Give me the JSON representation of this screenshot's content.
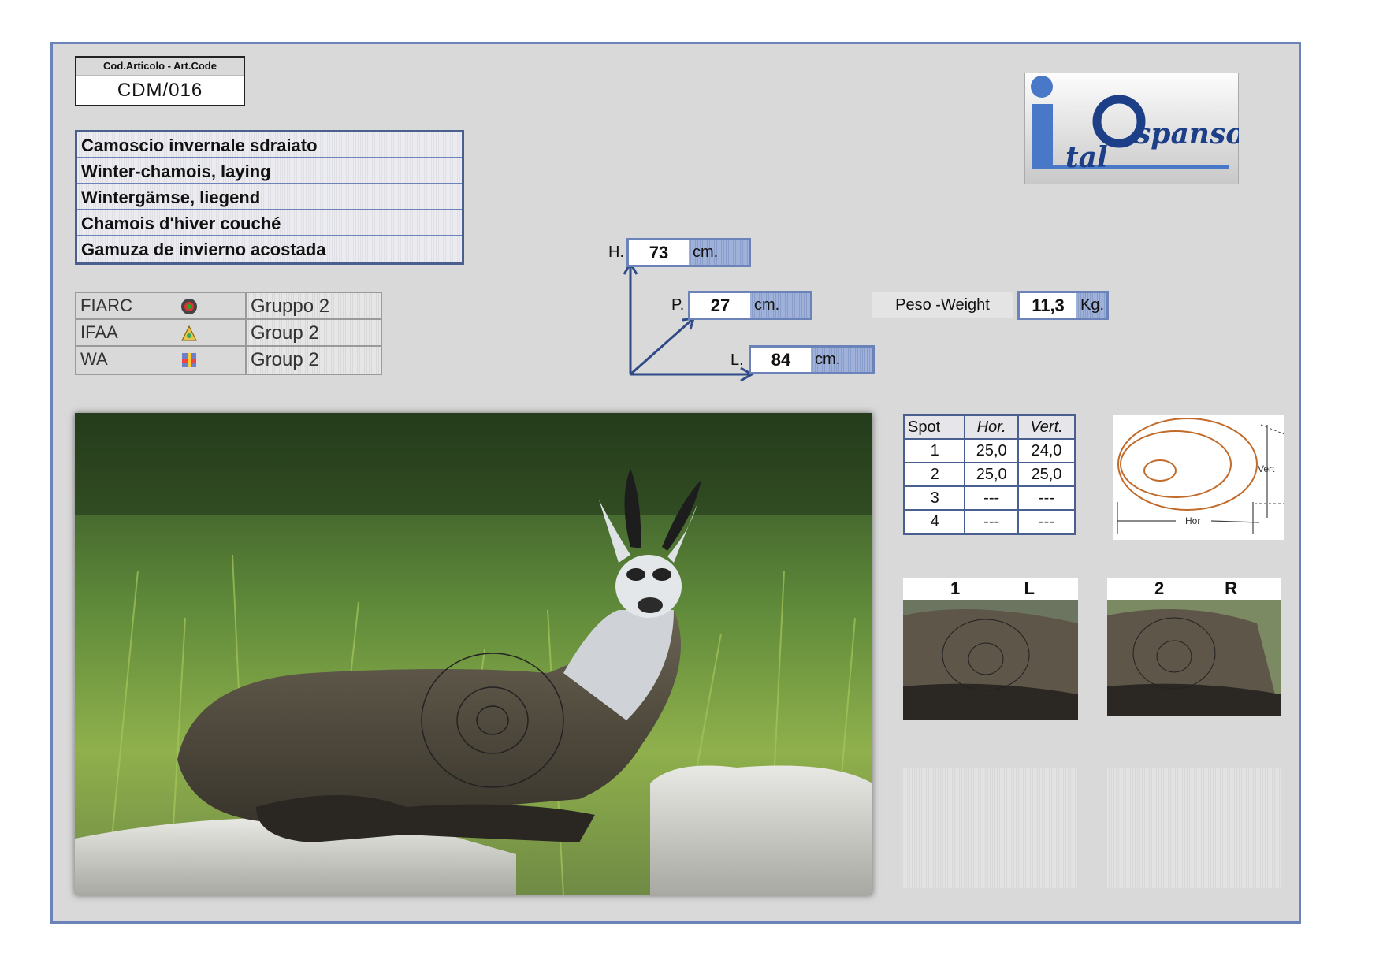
{
  "code": {
    "header": "Cod.Articolo - Art.Code",
    "value": "CDM/016"
  },
  "names": [
    "Camoscio invernale sdraiato",
    "Winter-chamois, laying",
    "Wintergämse, liegend",
    "Chamois d'hiver couché",
    "Gamuza de invierno acostada"
  ],
  "logo": {
    "text_top": "spanso",
    "text_bottom": "tal"
  },
  "groups": [
    {
      "org": "FIARC",
      "icon": "fiarc-logo-icon",
      "group": "Gruppo 2"
    },
    {
      "org": "IFAA",
      "icon": "ifaa-logo-icon",
      "group": "Group 2"
    },
    {
      "org": "WA",
      "icon": "wa-logo-icon",
      "group": "Group 2"
    }
  ],
  "dimensions": {
    "height": {
      "label": "H.",
      "value": "73",
      "unit": "cm."
    },
    "depth": {
      "label": "P.",
      "value": "27",
      "unit": "cm."
    },
    "length": {
      "label": "L.",
      "value": "84",
      "unit": "cm."
    }
  },
  "weight": {
    "label": "Peso -Weight",
    "value": "11,3",
    "unit": "Kg."
  },
  "spots": {
    "headers": [
      "Spot",
      "Hor.",
      "Vert."
    ],
    "rows": [
      [
        "1",
        "25,0",
        "24,0"
      ],
      [
        "2",
        "25,0",
        "25,0"
      ],
      [
        "3",
        "---",
        "---"
      ],
      [
        "4",
        "---",
        "---"
      ]
    ]
  },
  "spot_diagram": {
    "vert_label": "Vert",
    "hor_label": "Hor"
  },
  "spot_views": [
    {
      "num": "1",
      "side": "L"
    },
    {
      "num": "2",
      "side": "R"
    }
  ],
  "colors": {
    "frame": "#6b83b8",
    "sheet": "#d9d9d9",
    "dim_box": "#8fa3d0",
    "logo_blue": "#4a78c8"
  }
}
